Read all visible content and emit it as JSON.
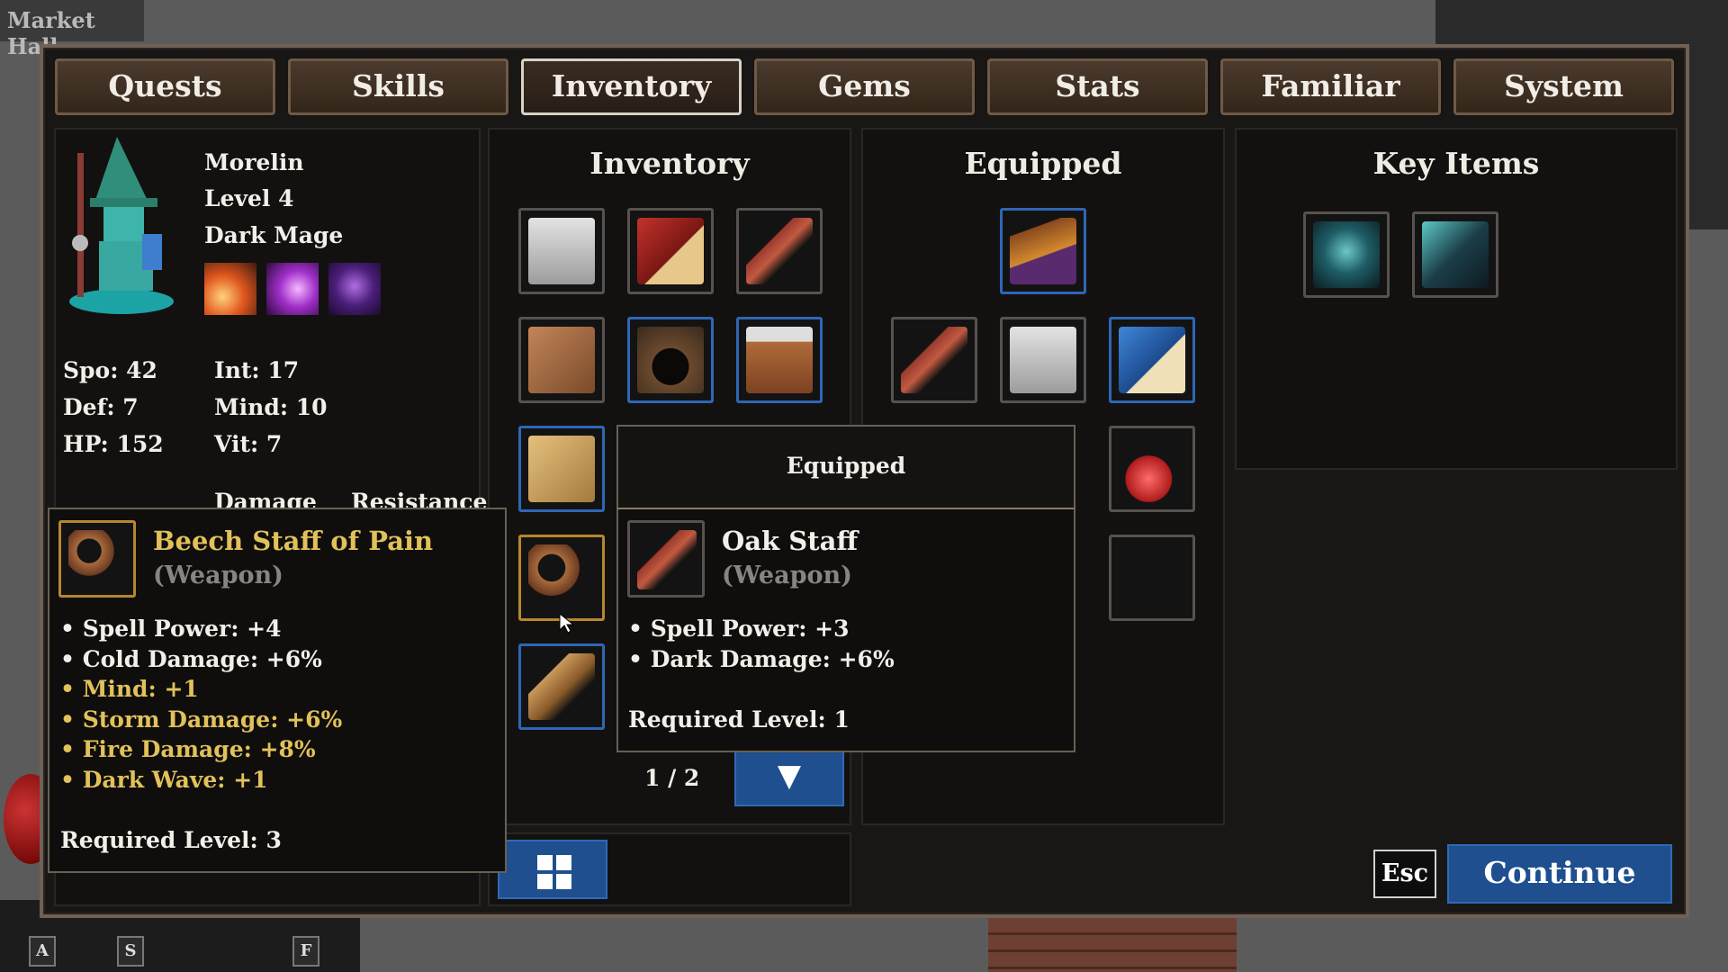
{
  "location": "Market Hall",
  "tabs": [
    "Quests",
    "Skills",
    "Inventory",
    "Gems",
    "Stats",
    "Familiar",
    "System"
  ],
  "active_tab": "Inventory",
  "character": {
    "name": "Morelin",
    "level": "Level 4",
    "class": "Dark Mage",
    "skills": [
      "fire-comet-icon",
      "arcane-swirl-icon",
      "shadow-figure-icon"
    ],
    "stats_left": [
      "Spo: 42",
      "Def: 7",
      "HP: 152"
    ],
    "stats_right": [
      "Int: 17",
      "Mind: 10",
      "Vit: 7"
    ],
    "col_headers": [
      "Damage",
      "Resistance"
    ]
  },
  "inventory": {
    "title": "Inventory",
    "page": "1 / 2",
    "items": [
      "robe-icon",
      "red-tome-icon",
      "staff-icon",
      "leather-scrap-icon",
      "hood-icon",
      "boot-icon",
      "scroll-book-icon",
      "curved-staff-icon",
      "wooden-staff-icon"
    ]
  },
  "equipped": {
    "title": "Equipped",
    "items": [
      "wizard-hat-icon",
      "staff-icon",
      "robe-icon",
      "blue-tome-icon",
      "red-potion-icon"
    ]
  },
  "key_items": {
    "title": "Key Items",
    "items": [
      "helmet-orb-icon",
      "eye-shard-icon"
    ]
  },
  "tooltip_hover": {
    "name": "Beech Staff of Pain",
    "type": "(Weapon)",
    "white_stats": [
      "Spell Power: +4",
      "Cold Damage: +6%"
    ],
    "gold_stats": [
      "Mind: +1",
      "Storm Damage: +6%",
      "Fire Damage: +8%",
      "Dark Wave: +1"
    ],
    "required": "Required Level: 3"
  },
  "tooltip_equipped": {
    "header": "Equipped",
    "name": "Oak Staff",
    "type": "(Weapon)",
    "stats": [
      "Spell Power: +3",
      "Dark Damage: +6%"
    ],
    "required": "Required Level: 1"
  },
  "buttons": {
    "esc": "Esc",
    "continue": "Continue"
  },
  "hotkeys": [
    "A",
    "S",
    "F"
  ],
  "colors": {
    "accent_blue": "#1f4f8e",
    "gold_text": "#e2c15a",
    "frame": "#6f6155"
  }
}
